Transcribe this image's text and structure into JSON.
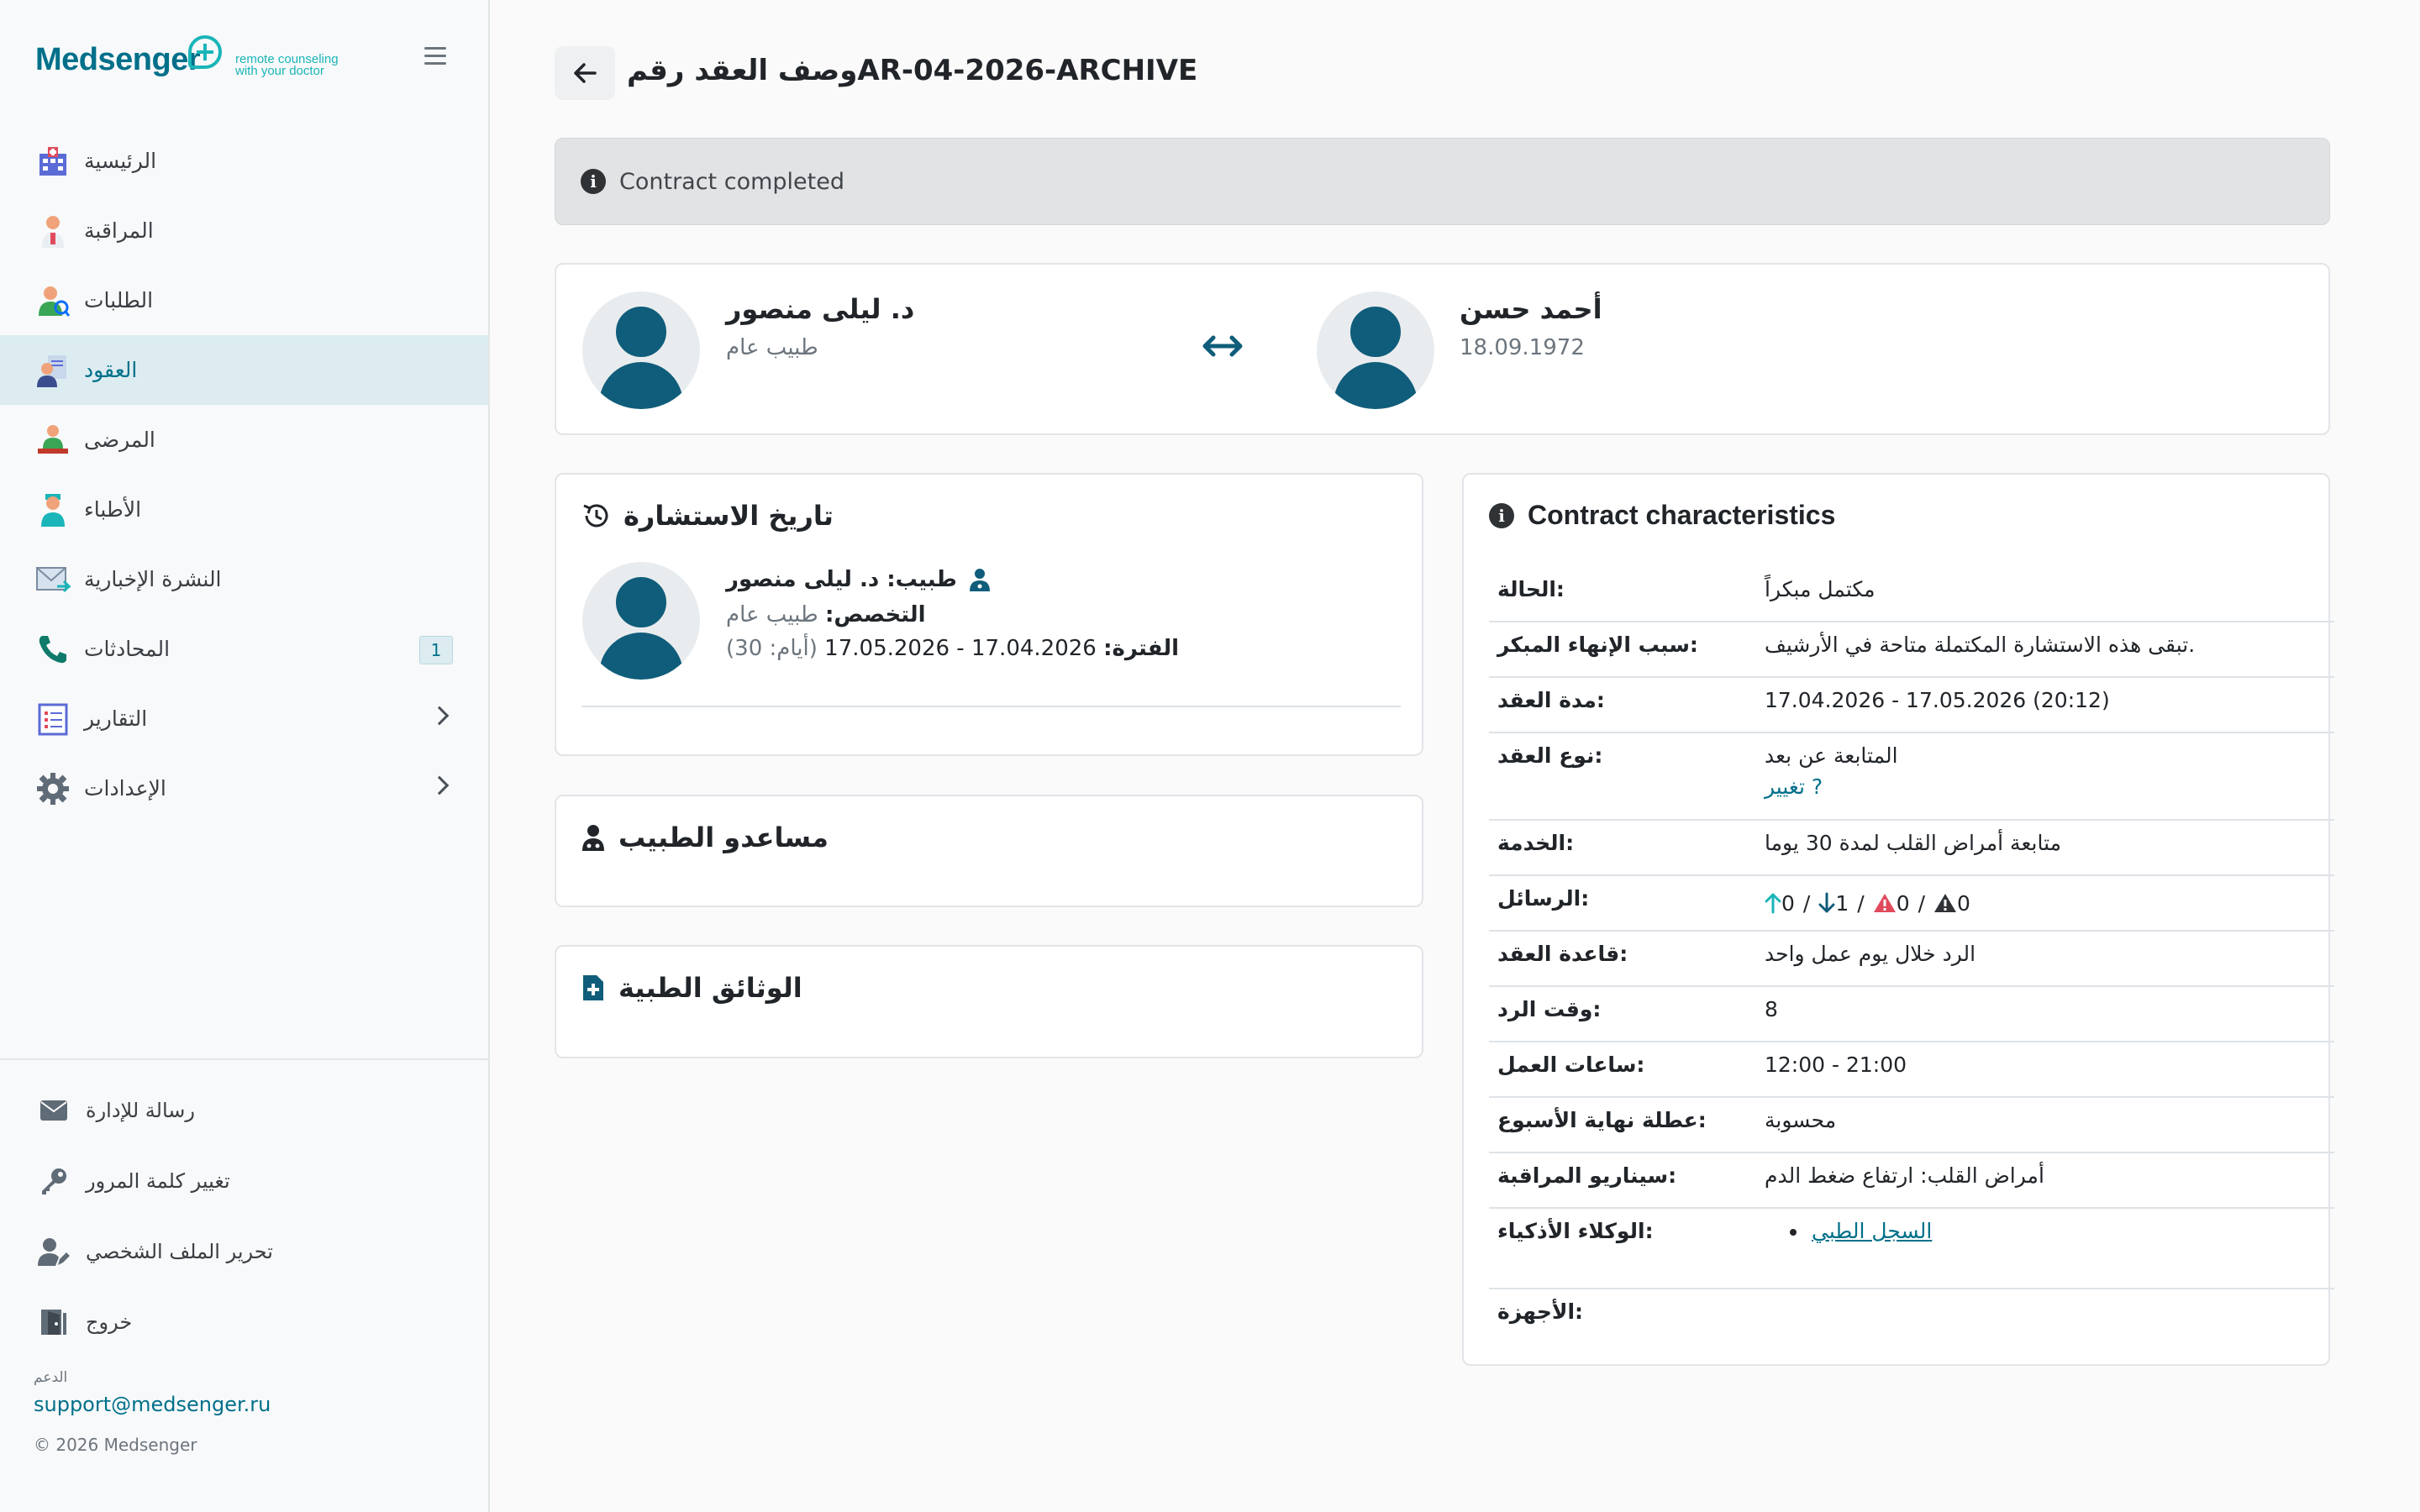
{
  "brand": {
    "logo_main": "Medsenger",
    "logo_tag_line1": "remote counseling",
    "logo_tag_line2": "with your doctor",
    "accent": "#00708a",
    "teal": "#1ab5b8"
  },
  "sidebar": {
    "items": [
      {
        "label": "الرئيسية",
        "icon": "hospital-icon"
      },
      {
        "label": "المراقبة",
        "icon": "doctor-monitor-icon"
      },
      {
        "label": "الطلبات",
        "icon": "requests-icon"
      },
      {
        "label": "العقود",
        "icon": "contracts-icon",
        "active": true
      },
      {
        "label": "المرضى",
        "icon": "patients-icon"
      },
      {
        "label": "الأطباء",
        "icon": "doctors-icon"
      },
      {
        "label": "النشرة الإخبارية",
        "icon": "newsletter-icon"
      },
      {
        "label": "المحادثات",
        "icon": "phone-icon",
        "badge": "1"
      },
      {
        "label": "التقارير",
        "icon": "reports-icon",
        "chevron": true
      },
      {
        "label": "الإعدادات",
        "icon": "gear-icon",
        "chevron": true
      }
    ],
    "bottom": [
      {
        "label": "رسالة للإدارة",
        "icon": "envelope-icon"
      },
      {
        "label": "تغيير كلمة المرور",
        "icon": "key-icon"
      },
      {
        "label": "تحرير الملف الشخصي",
        "icon": "user-edit-icon"
      },
      {
        "label": "خروج",
        "icon": "exit-door-icon"
      }
    ],
    "support_label": "الدعم",
    "support_email": "support@medsenger.ru",
    "copyright": "© 2026 Medsenger"
  },
  "header": {
    "title": "وصف العقد رقمAR-04-2026-ARCHIVE"
  },
  "alert": {
    "text": "Contract completed"
  },
  "parties": {
    "doctor": {
      "name": "د. ليلى منصور",
      "role": "طبيب عام"
    },
    "patient": {
      "name": "أحمد حسن",
      "dob": "18.09.1972"
    }
  },
  "history": {
    "title": "تاريخ الاستشارة",
    "doctor_line": "طبيب: د. ليلى منصور",
    "spec_label": "التخصص:",
    "spec_value": "طبيب عام",
    "period_label": "الفترة:",
    "period_value": "17.04.2026 - 17.05.2026",
    "period_days": "(أيام: 30)"
  },
  "assistants": {
    "title": "مساعدو الطبيب"
  },
  "documents": {
    "title": "الوثائق الطبية"
  },
  "characteristics": {
    "title": "Contract characteristics",
    "rows": {
      "status": {
        "k": "الحالة:",
        "v": "مكتمل مبكراً"
      },
      "reason": {
        "k": "سبب الإنهاء المبكر:",
        "v": "تبقى هذه الاستشارة المكتملة متاحة في الأرشيف."
      },
      "duration": {
        "k": "مدة العقد:",
        "v": "17.04.2026 - 17.05.2026 (20:12)"
      },
      "type": {
        "k": "نوع العقد:",
        "v": "المتابعة عن بعد",
        "link": "تغيير ?"
      },
      "service": {
        "k": "الخدمة:",
        "v": "متابعة أمراض القلب لمدة 30 يوما"
      },
      "messages": {
        "k": "الرسائل:",
        "out": "0",
        "in": "1",
        "warn": "0",
        "alert": "0",
        "sep": "/"
      },
      "rule": {
        "k": "قاعدة العقد:",
        "v": "الرد خلال يوم عمل واحد"
      },
      "response": {
        "k": "وقت الرد:",
        "v": "8"
      },
      "hours": {
        "k": "ساعات العمل:",
        "v": "12:00 - 21:00"
      },
      "weekend": {
        "k": "عطلة نهاية الأسبوع:",
        "v": "محسوبة"
      },
      "scenario": {
        "k": "سيناريو المراقبة:",
        "v": "أمراض القلب: ارتفاع ضغط الدم"
      },
      "agents": {
        "k": "الوكلاء الأذكياء:",
        "v": "السجل الطبي"
      },
      "devices": {
        "k": "الأجهزة:",
        "v": ""
      }
    }
  }
}
